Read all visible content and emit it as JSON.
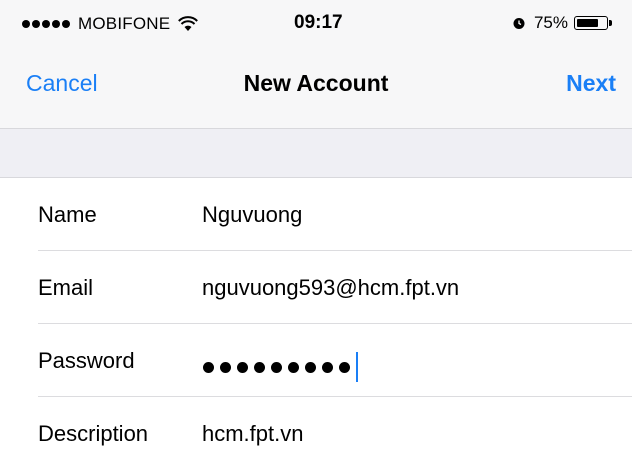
{
  "status_bar": {
    "carrier": "MOBIFONE",
    "time": "09:17",
    "battery_percent": "75%",
    "battery_level": 0.75,
    "signal_bars": 5
  },
  "nav": {
    "cancel_label": "Cancel",
    "title": "New Account",
    "next_label": "Next"
  },
  "form": {
    "fields": [
      {
        "label": "Name",
        "value": "Nguvuong"
      },
      {
        "label": "Email",
        "value": "nguvuong593@hcm.fpt.vn"
      },
      {
        "label": "Password",
        "masked_length": 9
      },
      {
        "label": "Description",
        "value": "hcm.fpt.vn"
      }
    ]
  },
  "colors": {
    "accent": "#1a7ff6",
    "bar_background": "#f7f7f8",
    "separator": "#efeff4"
  }
}
